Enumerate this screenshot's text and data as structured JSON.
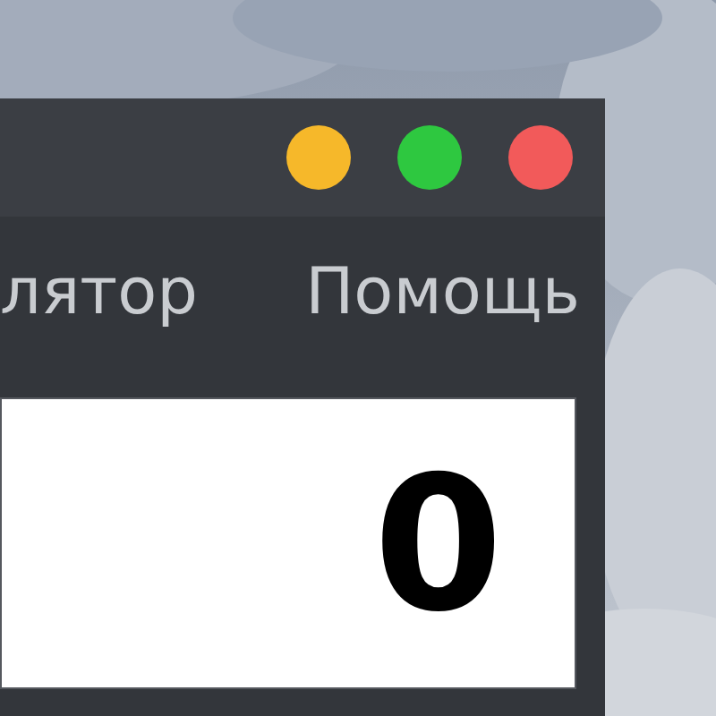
{
  "window": {
    "controls": [
      {
        "color": "#f6b82a"
      },
      {
        "color": "#2ec840"
      },
      {
        "color": "#f25a5a"
      }
    ],
    "menu": [
      {
        "label": "лятор"
      },
      {
        "label": "Помощь"
      }
    ],
    "display": {
      "value": "0"
    }
  }
}
